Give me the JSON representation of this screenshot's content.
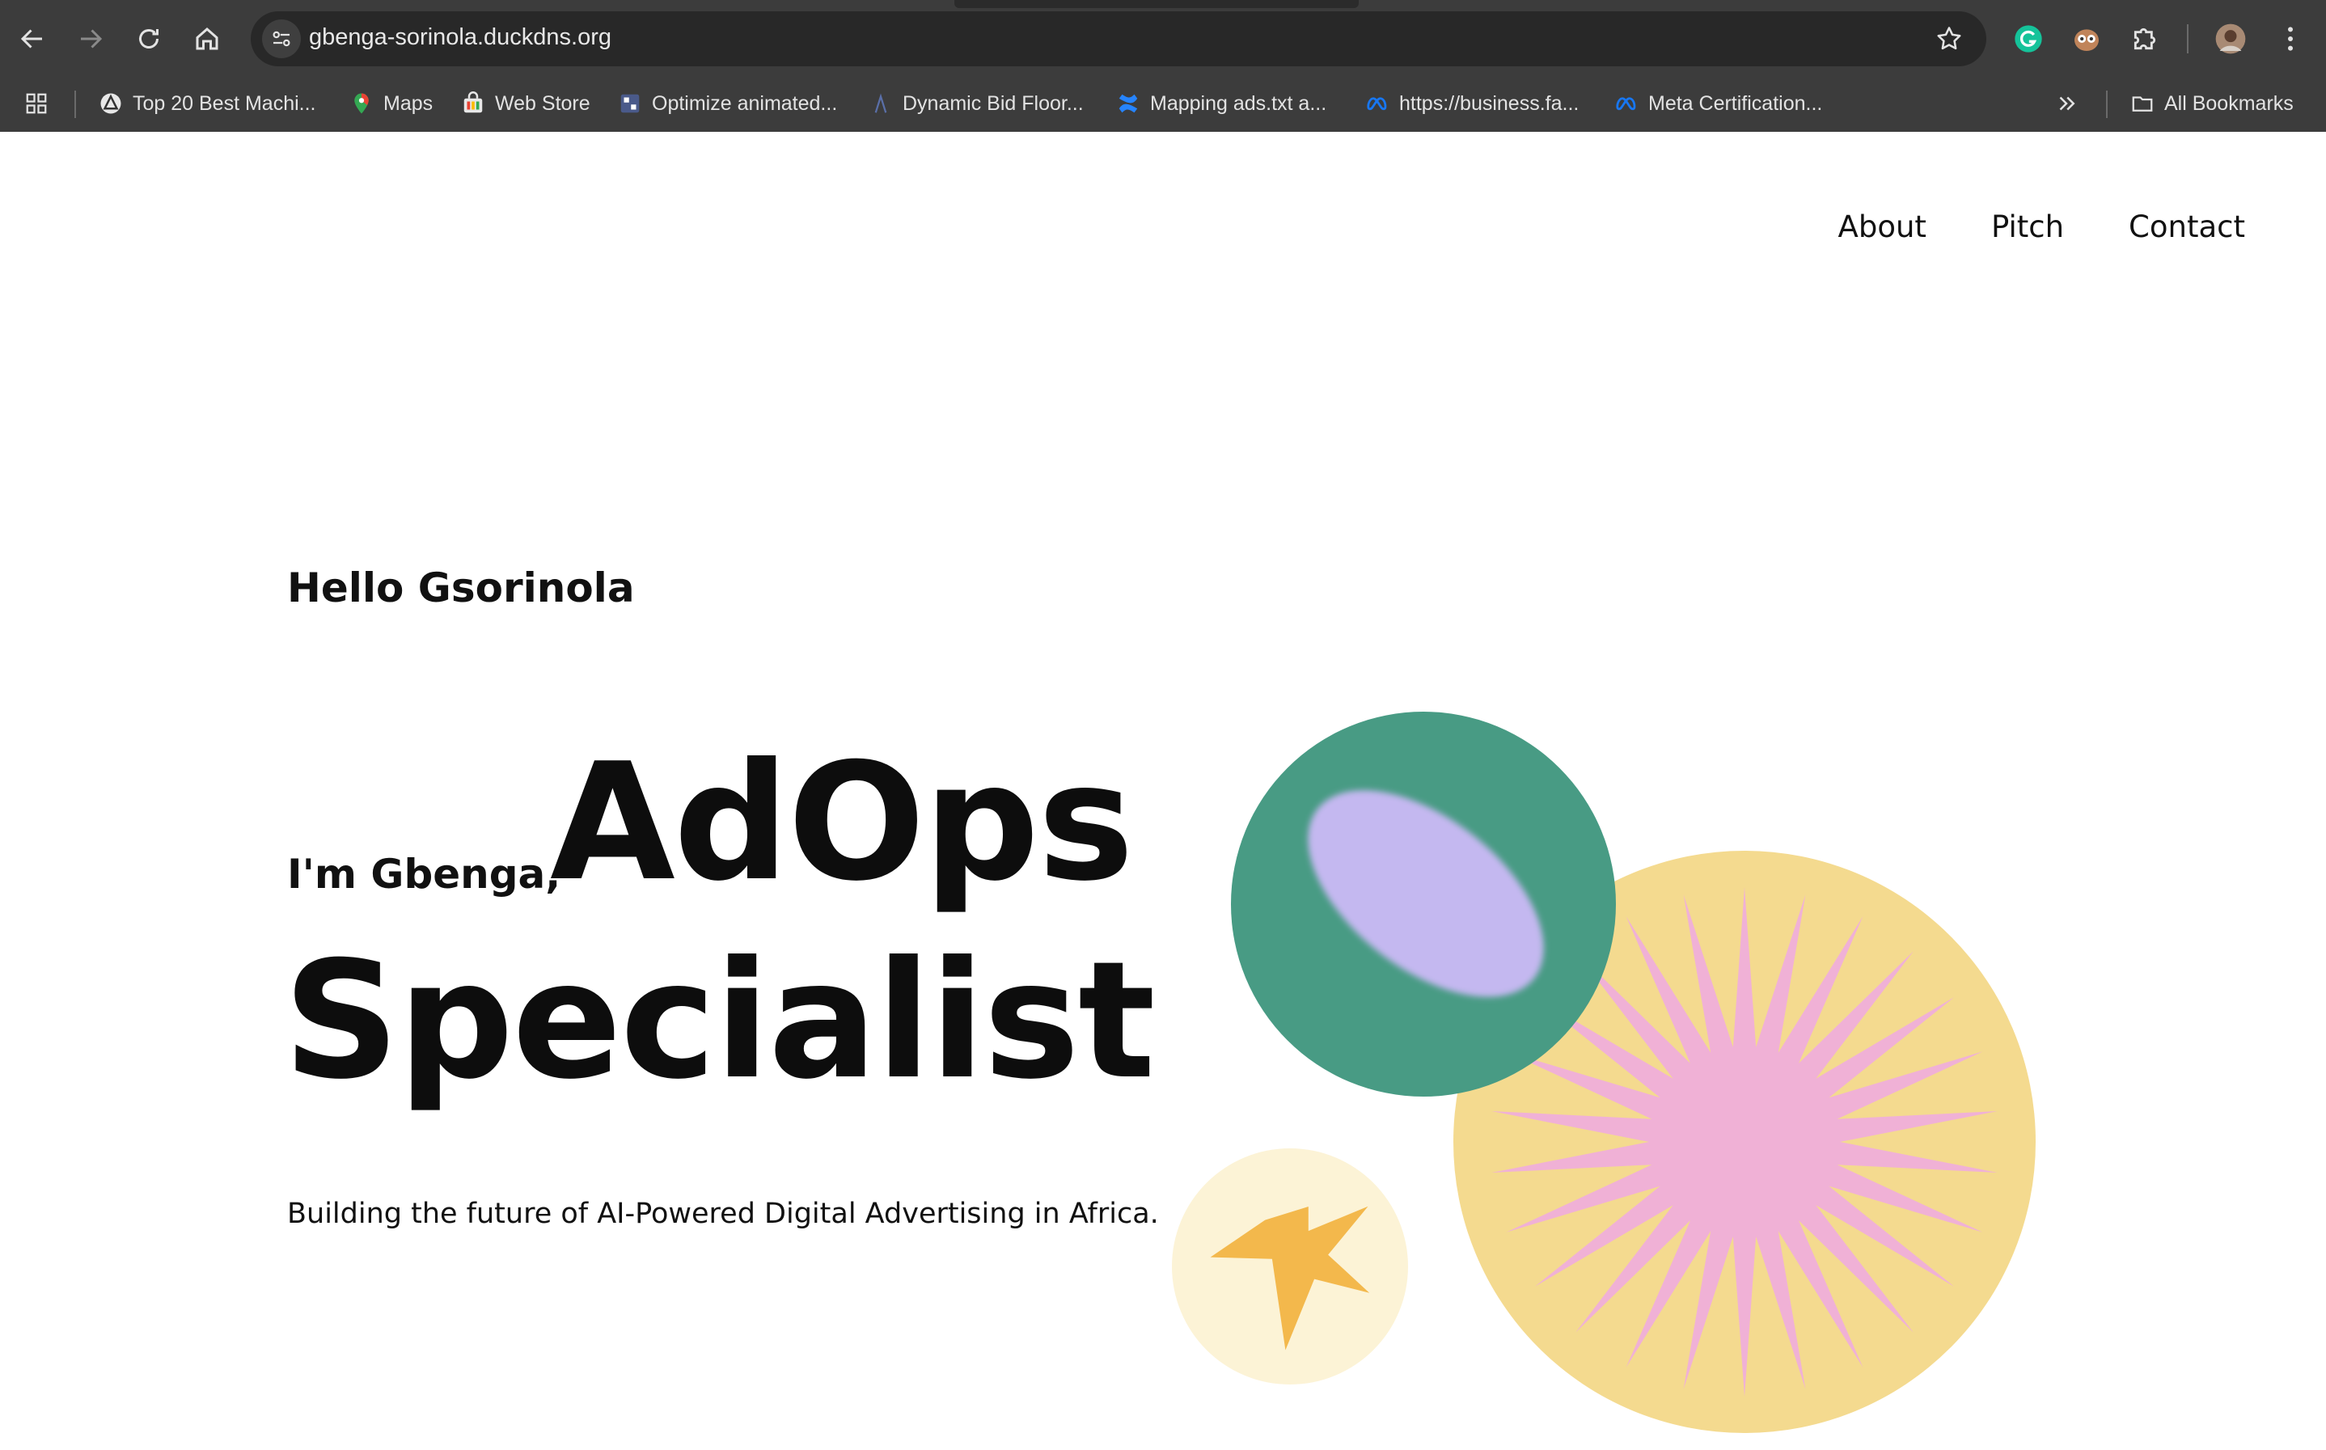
{
  "browser": {
    "url": "gbenga-sorinola.duckdns.org",
    "bookmarks": [
      {
        "label": "Top 20 Best Machi...",
        "icon": "triangle-logo-icon"
      },
      {
        "label": "Maps",
        "icon": "maps-pin-icon"
      },
      {
        "label": "Web Store",
        "icon": "web-store-icon"
      },
      {
        "label": "Optimize animated...",
        "icon": "optimize-icon"
      },
      {
        "label": "Dynamic Bid Floor...",
        "icon": "lambda-icon"
      },
      {
        "label": "Mapping ads.txt a...",
        "icon": "confluence-icon"
      },
      {
        "label": "https://business.fa...",
        "icon": "meta-icon"
      },
      {
        "label": "Meta Certification...",
        "icon": "meta-icon"
      }
    ],
    "all_bookmarks_label": "All Bookmarks"
  },
  "nav": {
    "about": "About",
    "pitch": "Pitch",
    "contact": "Contact"
  },
  "hero": {
    "greeting": "Hello Gsorinola",
    "intro": "I'm Gbenga,",
    "title_line1": "AdOps",
    "title_line2": "Specialist",
    "tagline": "Building the future of AI-Powered Digital Advertising in Africa."
  },
  "colors": {
    "green_circle": "#489b84",
    "lavender": "#c4b8f0",
    "yellow_circle": "#f4da8f",
    "pink_starburst": "#f0b1d6",
    "cream_circle": "#fcf3d6",
    "orange_star": "#f3b84c"
  }
}
